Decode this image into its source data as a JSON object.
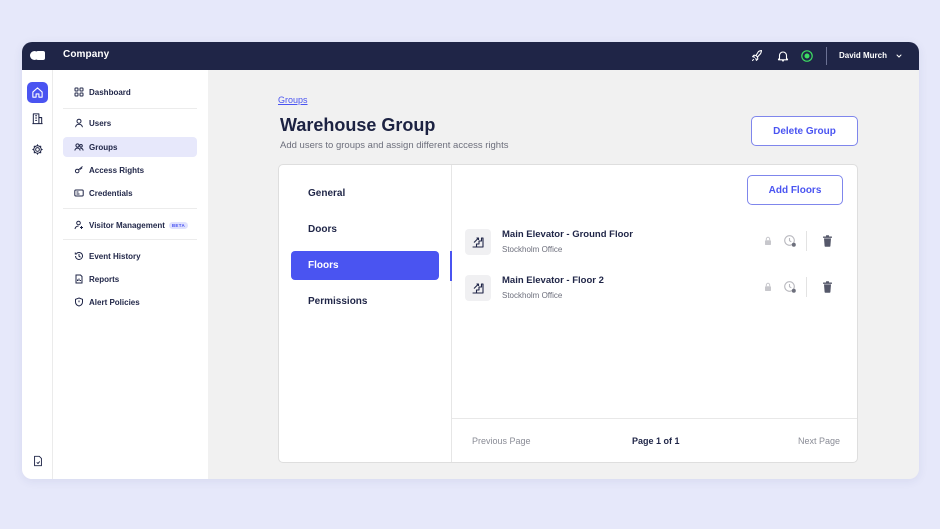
{
  "topbar": {
    "company": "Company",
    "user_name": "David Murch",
    "icons": [
      "rocket-icon",
      "bell-icon",
      "status-online-icon",
      "chevron-down-icon"
    ],
    "status_color": "#3ddc62"
  },
  "rail": {
    "items": [
      "home-icon",
      "building-icon",
      "gear-icon"
    ],
    "bottom_item": "document-icon"
  },
  "sidebar": {
    "items": [
      {
        "label": "Dashboard",
        "icon": "grid-icon"
      },
      {
        "label": "Users",
        "icon": "user-icon"
      },
      {
        "label": "Groups",
        "icon": "users-icon",
        "active": true
      },
      {
        "label": "Access Rights",
        "icon": "key-icon"
      },
      {
        "label": "Credentials",
        "icon": "card-icon"
      },
      {
        "label": "Visitor Management",
        "icon": "visitor-icon",
        "badge": "BETA"
      },
      {
        "label": "Event History",
        "icon": "history-icon"
      },
      {
        "label": "Reports",
        "icon": "report-icon"
      },
      {
        "label": "Alert Policies",
        "icon": "shield-icon"
      }
    ]
  },
  "main": {
    "breadcrumb": "Groups",
    "title": "Warehouse Group",
    "subtitle": "Add users to groups and assign different access rights",
    "delete_label": "Delete Group",
    "tabs": [
      {
        "label": "General"
      },
      {
        "label": "Doors"
      },
      {
        "label": "Floors",
        "active": true
      },
      {
        "label": "Permissions"
      }
    ],
    "add_label": "Add Floors",
    "floors": [
      {
        "name": "Main Elevator - Ground Floor",
        "location": "Stockholm Office"
      },
      {
        "name": "Main Elevator - Floor 2",
        "location": "Stockholm Office"
      }
    ],
    "row_icons": [
      "lock-icon",
      "clock-icon",
      "trash-icon"
    ],
    "pagination": {
      "previous": "Previous Page",
      "info": "Page 1 of 1",
      "next": "Next Page"
    }
  },
  "colors": {
    "accent": "#4a54f1",
    "topbar": "#1f2547",
    "background": "#e6e8fa"
  }
}
